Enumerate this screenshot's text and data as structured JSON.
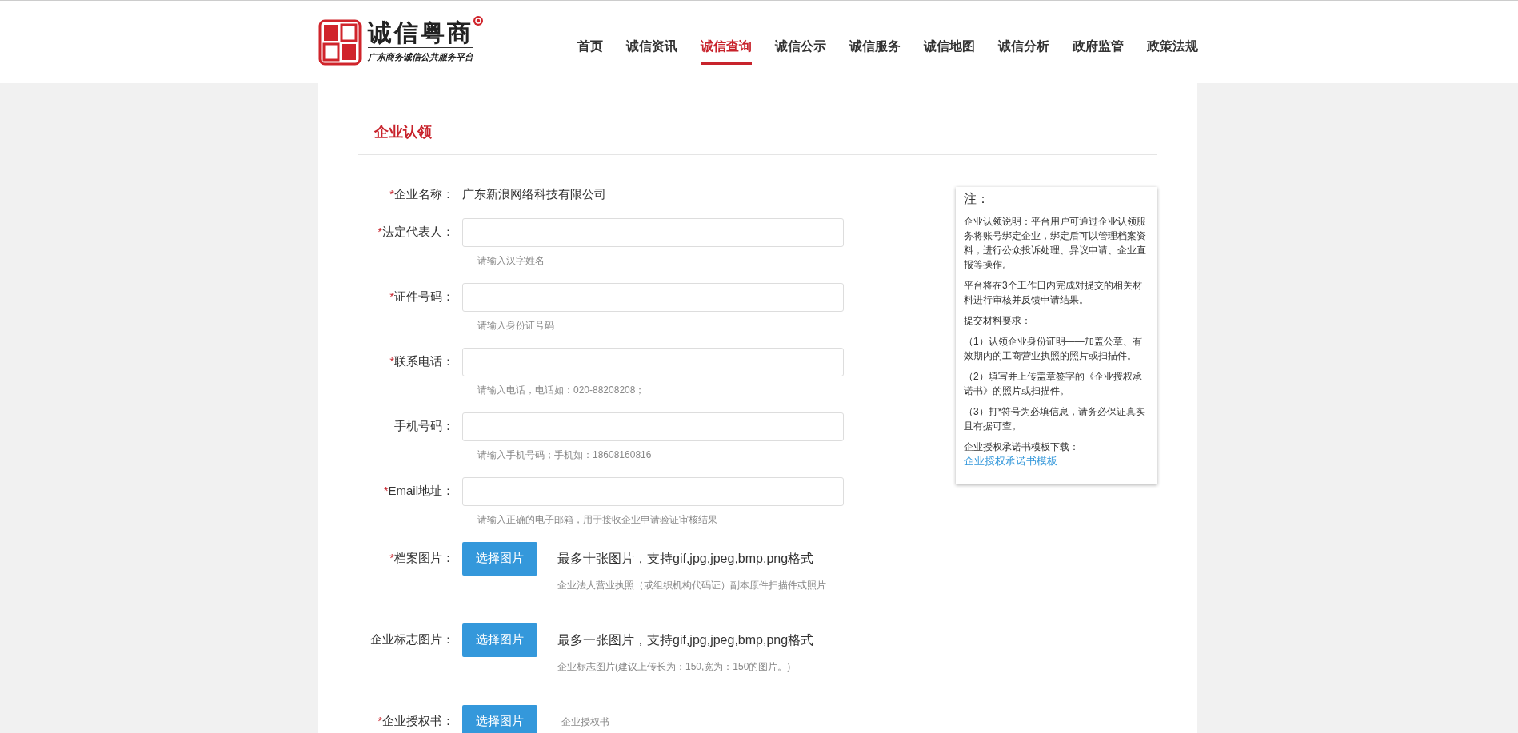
{
  "header": {
    "logo_title": "诚信粤商",
    "logo_subtitle": "广东商务诚信公共服务平台",
    "nav": [
      {
        "label": "首页",
        "selected": false
      },
      {
        "label": "诚信资讯",
        "selected": false
      },
      {
        "label": "诚信查询",
        "selected": true
      },
      {
        "label": "诚信公示",
        "selected": false
      },
      {
        "label": "诚信服务",
        "selected": false
      },
      {
        "label": "诚信地图",
        "selected": false
      },
      {
        "label": "诚信分析",
        "selected": false
      },
      {
        "label": "政府监管",
        "selected": false
      },
      {
        "label": "政策法规",
        "selected": false
      }
    ]
  },
  "section_title": "企业认领",
  "form": {
    "fields": [
      {
        "kind": "static",
        "required_mark": "*",
        "label": "企业名称：",
        "value": "广东新浪网络科技有限公司"
      },
      {
        "kind": "input",
        "required_mark": "*",
        "label": "法定代表人：",
        "hint": "请输入汉字姓名"
      },
      {
        "kind": "input",
        "required_mark": "*",
        "label": "证件号码：",
        "hint": "请输入身份证号码"
      },
      {
        "kind": "input",
        "required_mark": "*",
        "label": "联系电话：",
        "hint": "请输入电话，电话如：020-88208208；"
      },
      {
        "kind": "input",
        "label": "手机号码：",
        "hint": "请输入手机号码；手机如：18608160816"
      },
      {
        "kind": "input",
        "required_mark": "*",
        "label": "Email地址：",
        "hint": "请输入正确的电子邮箱，用于接收企业申请验证审核结果"
      },
      {
        "kind": "upload",
        "required_mark": "*",
        "label": "档案图片：",
        "button": "选择图片",
        "note": "最多十张图片，支持gif,jpg,jpeg,bmp,png格式",
        "hint": "企业法人营业执照（或组织机构代码证）副本原件扫描件或照片"
      },
      {
        "kind": "upload",
        "label": "企业标志图片：",
        "button": "选择图片",
        "note": "最多一张图片，支持gif,jpg,jpeg,bmp,png格式",
        "hint": "企业标志图片(建议上传长为：150,宽为：150的图片。)"
      },
      {
        "kind": "upload",
        "required_mark": "*",
        "label": "企业授权书：",
        "button": "选择图片",
        "hint": "企业授权书"
      }
    ]
  },
  "notes": {
    "title": "注：",
    "paragraphs": [
      "企业认领说明：平台用户可通过企业认领服务将账号绑定企业，绑定后可以管理档案资料，进行公众投诉处理、异议申请、企业直报等操作。",
      "平台将在3个工作日内完成对提交的相关材料进行审核并反馈申请结果。",
      "提交材料要求：",
      "（1）认领企业身份证明——加盖公章、有效期内的工商营业执照的照片或扫描件。",
      "（2）填写并上传盖章签字的《企业授权承诺书》的照片或扫描件。",
      "（3）打*符号为必填信息，请务必保证真实且有据可查。"
    ],
    "download_label": "企业授权承诺书模板下载：",
    "download_link": "企业授权承诺书模板"
  }
}
